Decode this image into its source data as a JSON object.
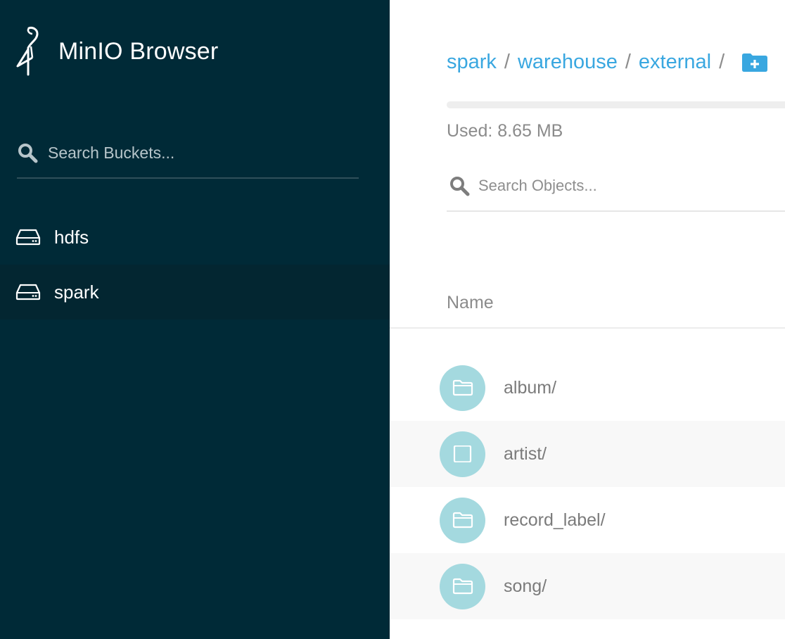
{
  "app": {
    "title": "MinIO Browser"
  },
  "sidebar": {
    "search": {
      "placeholder": "Search Buckets..."
    },
    "buckets": [
      {
        "label": "hdfs",
        "active": false
      },
      {
        "label": "spark",
        "active": true
      }
    ]
  },
  "main": {
    "breadcrumb": [
      {
        "label": "spark"
      },
      {
        "label": "warehouse"
      },
      {
        "label": "external"
      }
    ],
    "breadcrumb_separator": "/",
    "usage": {
      "label": "Used: 8.65 MB",
      "fraction": 0.0
    },
    "search": {
      "placeholder": "Search Objects..."
    },
    "columns": {
      "name": "Name"
    },
    "objects": [
      {
        "name": "album/",
        "icon": "folder-icon"
      },
      {
        "name": "artist/",
        "icon": "checkbox-icon"
      },
      {
        "name": "record_label/",
        "icon": "folder-icon"
      },
      {
        "name": "song/",
        "icon": "folder-icon"
      }
    ]
  },
  "colors": {
    "sidebar_bg": "#002a37",
    "accent": "#39a7e0",
    "avatar_bg": "#a4d9df"
  }
}
